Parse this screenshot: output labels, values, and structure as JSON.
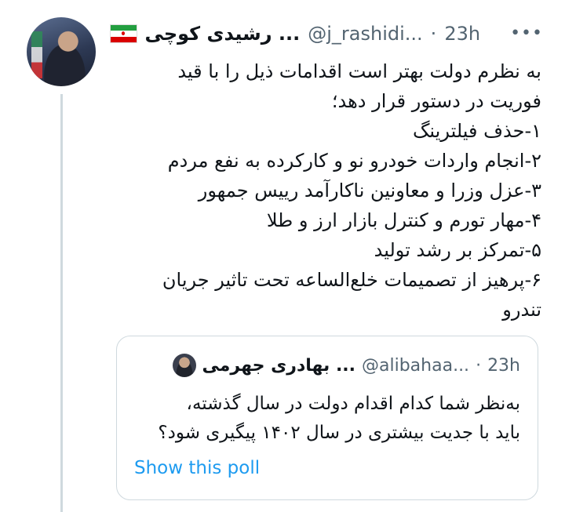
{
  "tweet": {
    "display_name": "... رشیدی کوچی",
    "handle": "@j_rashidi...",
    "separator": "·",
    "time": "23h",
    "more_icon": "more-horizontal-icon",
    "flag_icon": "iran-flag-icon",
    "lines": [
      "به نظرم دولت بهتر است اقدامات ذیل را با قید",
      "فوریت در دستور قرار دهد؛",
      "۱-حذف فیلترینگ",
      "۲-انجام واردات خودرو نو و کارکرده به نفع مردم",
      "۳-عزل وزرا و معاونین ناکارآمد رییس جمهور",
      "۴-مهار تورم و کنترل بازار ارز و طلا",
      "۵-تمرکز بر رشد تولید",
      "۶-پرهیز از تصمیمات خلع‌الساعه تحت تاثیر جریان",
      "تندرو"
    ]
  },
  "quote": {
    "display_name": "... بهادری جهرمی",
    "handle": "@alibahaa...",
    "separator": "·",
    "time": "23h",
    "lines": [
      "به‌نظر شما کدام اقدام دولت در سال گذشته،",
      "باید با جدیت بیشتری در سال ۱۴۰۲ پیگیری شود؟"
    ],
    "poll_link": "Show this poll"
  },
  "colors": {
    "text": "#0f1419",
    "secondary": "#536471",
    "link": "#1d9bf0",
    "border": "#cfd9de"
  }
}
